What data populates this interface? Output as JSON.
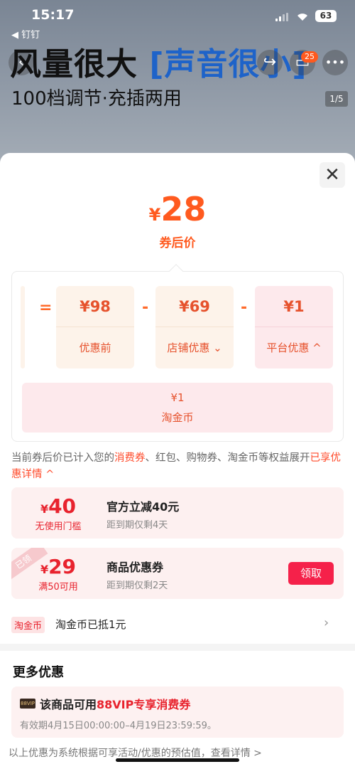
{
  "status_bar": {
    "time": "15:17",
    "battery": "63",
    "back_app": "◀ 钉钉"
  },
  "product": {
    "title_black": "风量很大",
    "title_blue": "[声音很小]",
    "subtitle": "100档调节·充插两用",
    "image_counter": "1/5",
    "cart_count": "25"
  },
  "price": {
    "currency": "¥",
    "final": "28",
    "final_label": "券后价",
    "equals": "=",
    "minus": "-",
    "items": [
      {
        "value": "¥98",
        "label": "优惠前"
      },
      {
        "value": "¥69",
        "label": "店铺优惠",
        "chevron": "down"
      },
      {
        "value": "¥1",
        "label": "平台优惠",
        "chevron": "up"
      }
    ],
    "coin": {
      "value": "¥1",
      "label": "淘金币"
    }
  },
  "note": {
    "text_before": "当前券后价已计入您的",
    "highlight1": "消费券",
    "text_middle": "、红包、购物券、淘金币等权益展开",
    "highlight2": "已享优惠详情"
  },
  "coupons": [
    {
      "currency": "¥",
      "amount": "40",
      "condition": "无使用门槛",
      "title": "官方立减40元",
      "expiry": "距到期仅剩4天"
    },
    {
      "currency": "¥",
      "amount": "29",
      "condition": "满50可用",
      "title": "商品优惠券",
      "expiry": "距到期仅剩2天",
      "ribbon": "已领",
      "button": "领取"
    }
  ],
  "coin_row": {
    "tag": "淘金币",
    "text": "淘金币已抵1元"
  },
  "more": {
    "title": "更多优惠",
    "vip_badge": "88VIP",
    "vip_prefix": "该商品可用",
    "vip_highlight": "88VIP专享消费券",
    "vip_validity": "有效期4月15日00:00:00–4月19日23:59:59。"
  },
  "footer": {
    "text": "以上优惠为系统根据可享活动/优惠的预估值，查看详情 >"
  },
  "colors": {
    "accent": "#ff5a1f",
    "red": "#e8232e",
    "claim_button": "#f5214a"
  }
}
